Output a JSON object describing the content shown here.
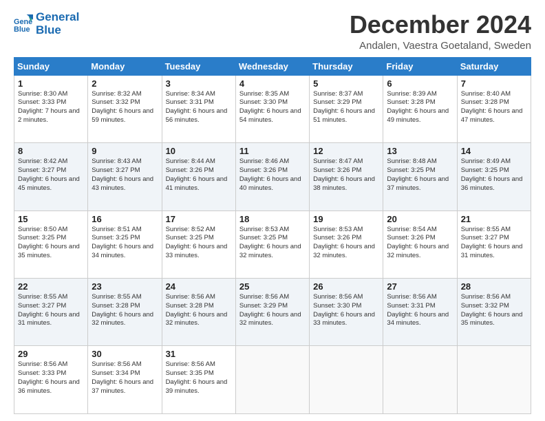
{
  "header": {
    "logo_line1": "General",
    "logo_line2": "Blue",
    "month_title": "December 2024",
    "subtitle": "Andalen, Vaestra Goetaland, Sweden"
  },
  "days_of_week": [
    "Sunday",
    "Monday",
    "Tuesday",
    "Wednesday",
    "Thursday",
    "Friday",
    "Saturday"
  ],
  "weeks": [
    [
      {
        "day": "1",
        "sunrise": "8:30 AM",
        "sunset": "3:33 PM",
        "daylight": "7 hours and 2 minutes."
      },
      {
        "day": "2",
        "sunrise": "8:32 AM",
        "sunset": "3:32 PM",
        "daylight": "6 hours and 59 minutes."
      },
      {
        "day": "3",
        "sunrise": "8:34 AM",
        "sunset": "3:31 PM",
        "daylight": "6 hours and 56 minutes."
      },
      {
        "day": "4",
        "sunrise": "8:35 AM",
        "sunset": "3:30 PM",
        "daylight": "6 hours and 54 minutes."
      },
      {
        "day": "5",
        "sunrise": "8:37 AM",
        "sunset": "3:29 PM",
        "daylight": "6 hours and 51 minutes."
      },
      {
        "day": "6",
        "sunrise": "8:39 AM",
        "sunset": "3:28 PM",
        "daylight": "6 hours and 49 minutes."
      },
      {
        "day": "7",
        "sunrise": "8:40 AM",
        "sunset": "3:28 PM",
        "daylight": "6 hours and 47 minutes."
      }
    ],
    [
      {
        "day": "8",
        "sunrise": "8:42 AM",
        "sunset": "3:27 PM",
        "daylight": "6 hours and 45 minutes."
      },
      {
        "day": "9",
        "sunrise": "8:43 AM",
        "sunset": "3:27 PM",
        "daylight": "6 hours and 43 minutes."
      },
      {
        "day": "10",
        "sunrise": "8:44 AM",
        "sunset": "3:26 PM",
        "daylight": "6 hours and 41 minutes."
      },
      {
        "day": "11",
        "sunrise": "8:46 AM",
        "sunset": "3:26 PM",
        "daylight": "6 hours and 40 minutes."
      },
      {
        "day": "12",
        "sunrise": "8:47 AM",
        "sunset": "3:26 PM",
        "daylight": "6 hours and 38 minutes."
      },
      {
        "day": "13",
        "sunrise": "8:48 AM",
        "sunset": "3:25 PM",
        "daylight": "6 hours and 37 minutes."
      },
      {
        "day": "14",
        "sunrise": "8:49 AM",
        "sunset": "3:25 PM",
        "daylight": "6 hours and 36 minutes."
      }
    ],
    [
      {
        "day": "15",
        "sunrise": "8:50 AM",
        "sunset": "3:25 PM",
        "daylight": "6 hours and 35 minutes."
      },
      {
        "day": "16",
        "sunrise": "8:51 AM",
        "sunset": "3:25 PM",
        "daylight": "6 hours and 34 minutes."
      },
      {
        "day": "17",
        "sunrise": "8:52 AM",
        "sunset": "3:25 PM",
        "daylight": "6 hours and 33 minutes."
      },
      {
        "day": "18",
        "sunrise": "8:53 AM",
        "sunset": "3:25 PM",
        "daylight": "6 hours and 32 minutes."
      },
      {
        "day": "19",
        "sunrise": "8:53 AM",
        "sunset": "3:26 PM",
        "daylight": "6 hours and 32 minutes."
      },
      {
        "day": "20",
        "sunrise": "8:54 AM",
        "sunset": "3:26 PM",
        "daylight": "6 hours and 32 minutes."
      },
      {
        "day": "21",
        "sunrise": "8:55 AM",
        "sunset": "3:27 PM",
        "daylight": "6 hours and 31 minutes."
      }
    ],
    [
      {
        "day": "22",
        "sunrise": "8:55 AM",
        "sunset": "3:27 PM",
        "daylight": "6 hours and 31 minutes."
      },
      {
        "day": "23",
        "sunrise": "8:55 AM",
        "sunset": "3:28 PM",
        "daylight": "6 hours and 32 minutes."
      },
      {
        "day": "24",
        "sunrise": "8:56 AM",
        "sunset": "3:28 PM",
        "daylight": "6 hours and 32 minutes."
      },
      {
        "day": "25",
        "sunrise": "8:56 AM",
        "sunset": "3:29 PM",
        "daylight": "6 hours and 32 minutes."
      },
      {
        "day": "26",
        "sunrise": "8:56 AM",
        "sunset": "3:30 PM",
        "daylight": "6 hours and 33 minutes."
      },
      {
        "day": "27",
        "sunrise": "8:56 AM",
        "sunset": "3:31 PM",
        "daylight": "6 hours and 34 minutes."
      },
      {
        "day": "28",
        "sunrise": "8:56 AM",
        "sunset": "3:32 PM",
        "daylight": "6 hours and 35 minutes."
      }
    ],
    [
      {
        "day": "29",
        "sunrise": "8:56 AM",
        "sunset": "3:33 PM",
        "daylight": "6 hours and 36 minutes."
      },
      {
        "day": "30",
        "sunrise": "8:56 AM",
        "sunset": "3:34 PM",
        "daylight": "6 hours and 37 minutes."
      },
      {
        "day": "31",
        "sunrise": "8:56 AM",
        "sunset": "3:35 PM",
        "daylight": "6 hours and 39 minutes."
      },
      null,
      null,
      null,
      null
    ]
  ],
  "labels": {
    "sunrise": "Sunrise:",
    "sunset": "Sunset:",
    "daylight": "Daylight:"
  }
}
